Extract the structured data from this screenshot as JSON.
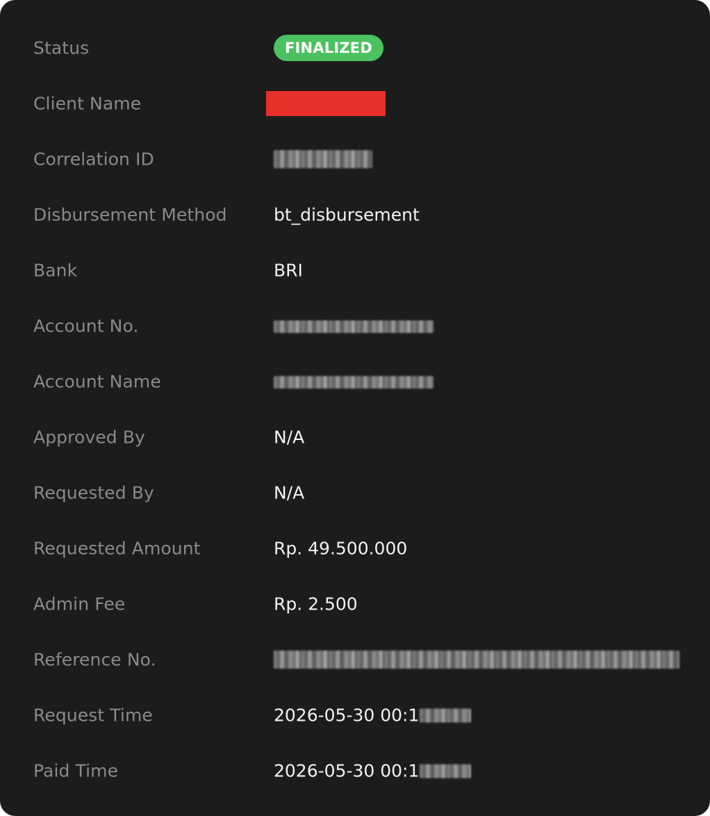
{
  "details": {
    "status": {
      "label": "Status",
      "value": "FINALIZED",
      "color": "#4cc15f"
    },
    "client_name": {
      "label": "Client Name",
      "value_redacted": true,
      "redaction_color": "#e8302a"
    },
    "correlation_id": {
      "label": "Correlation ID",
      "value_blurred": true
    },
    "disbursement_method": {
      "label": "Disbursement Method",
      "value": "bt_disbursement"
    },
    "bank": {
      "label": "Bank",
      "value": "BRI"
    },
    "account_no": {
      "label": "Account No.",
      "value_blurred": true
    },
    "account_name": {
      "label": "Account Name",
      "value_blurred": true
    },
    "approved_by": {
      "label": "Approved By",
      "value": "N/A"
    },
    "requested_by": {
      "label": "Requested By",
      "value": "N/A"
    },
    "requested_amount": {
      "label": "Requested Amount",
      "value": "Rp. 49.500.000"
    },
    "admin_fee": {
      "label": "Admin Fee",
      "value": "Rp. 2.500"
    },
    "reference_no": {
      "label": "Reference No.",
      "value_blurred": true
    },
    "request_time": {
      "label": "Request Time",
      "value_visible": "2026-05-30 00:1",
      "value_blurred_tail": true
    },
    "paid_time": {
      "label": "Paid Time",
      "value_visible": "2026-05-30 00:1",
      "value_blurred_tail": true
    }
  }
}
